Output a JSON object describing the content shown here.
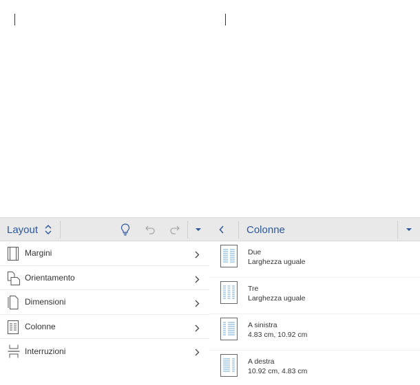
{
  "toolbar": {
    "title": "Layout",
    "panel_title": "Colonne",
    "icons": [
      "chevron-updown-icon",
      "lightbulb-icon",
      "undo-icon",
      "redo-icon",
      "dropdown-triangle-icon",
      "back-chevron-icon",
      "dropdown-triangle-icon"
    ]
  },
  "menu": {
    "items": [
      {
        "label": "Margini",
        "icon": "margins-icon"
      },
      {
        "label": "Orientamento",
        "icon": "orientation-icon"
      },
      {
        "label": "Dimensioni",
        "icon": "size-icon"
      },
      {
        "label": "Colonne",
        "icon": "columns-icon"
      },
      {
        "label": "Interruzioni",
        "icon": "breaks-icon"
      }
    ]
  },
  "columns": {
    "options": [
      {
        "name": "Due",
        "desc": "Larghezza uguale"
      },
      {
        "name": "Tre",
        "desc": "Larghezza uguale"
      },
      {
        "name": "A sinistra",
        "desc": "4.83 cm, 10.92 cm"
      },
      {
        "name": "A destra",
        "desc": "10.92 cm, 4.83 cm"
      }
    ]
  },
  "colors": {
    "accent": "#2b579a",
    "toolbar_bg": "#e9e9e9",
    "thumb_line": "#6fa8d6"
  }
}
